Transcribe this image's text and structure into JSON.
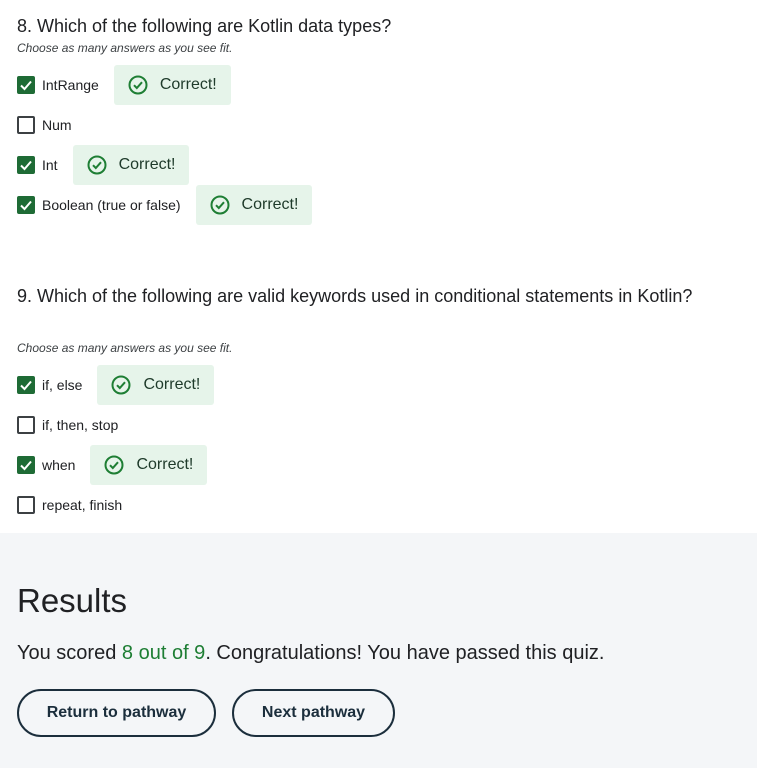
{
  "questions": [
    {
      "title": "8. Which of the following are Kotlin data types?",
      "hint": "Choose as many answers as you see fit.",
      "options": [
        {
          "label": "IntRange",
          "checked": true,
          "feedback": "Correct!"
        },
        {
          "label": "Num",
          "checked": false,
          "feedback": ""
        },
        {
          "label": "Int",
          "checked": true,
          "feedback": "Correct!"
        },
        {
          "label": "Boolean (true or false)",
          "checked": true,
          "feedback": "Correct!"
        }
      ]
    },
    {
      "title": "9. Which of the following are valid keywords used in conditional statements in Kotlin?",
      "hint": "Choose as many answers as you see fit.",
      "options": [
        {
          "label": "if, else",
          "checked": true,
          "feedback": "Correct!"
        },
        {
          "label": "if, then, stop",
          "checked": false,
          "feedback": ""
        },
        {
          "label": "when",
          "checked": true,
          "feedback": "Correct!"
        },
        {
          "label": "repeat, finish",
          "checked": false,
          "feedback": ""
        }
      ]
    }
  ],
  "results": {
    "title": "Results",
    "text_before": "You scored ",
    "score": "8 out of 9",
    "text_after": ". Congratulations! You have passed this quiz.",
    "return_button": "Return to pathway",
    "next_button": "Next pathway"
  },
  "colors": {
    "checkbox_checked": "#1e6b35",
    "correct_bg": "#e6f4ea",
    "score_green": "#1e7e34",
    "results_bg": "#f4f6f8"
  },
  "icons": {
    "checkbox_mark": "checkmark-icon",
    "feedback": "check-circle-icon"
  }
}
